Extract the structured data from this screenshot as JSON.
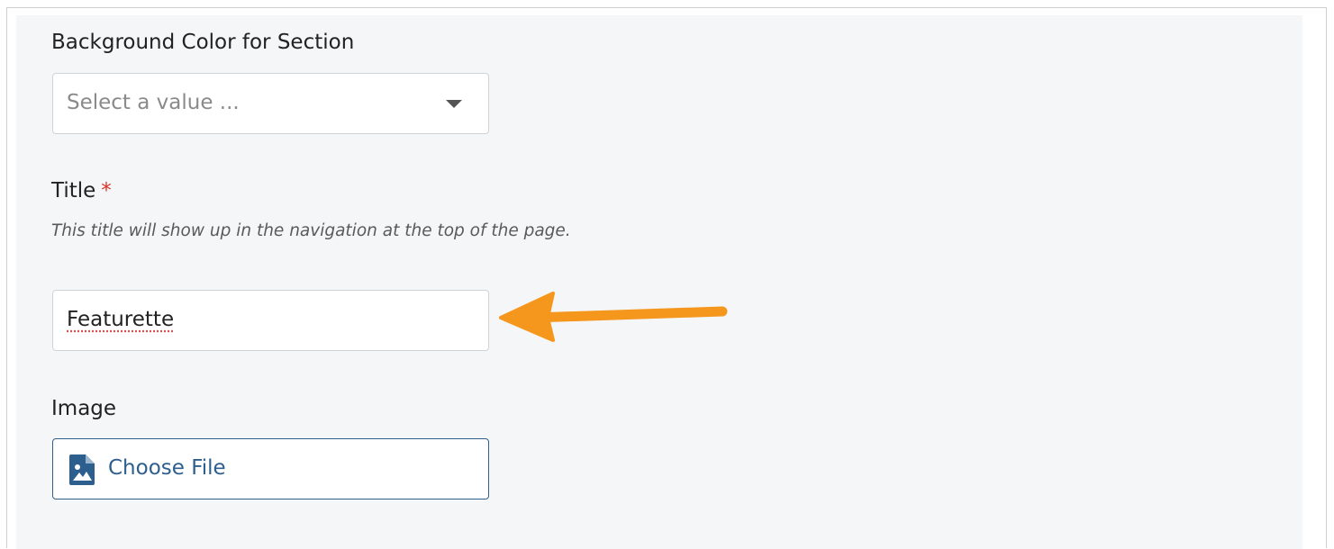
{
  "background_color_field": {
    "label": "Background Color for Section",
    "placeholder": "Select a value ..."
  },
  "title_field": {
    "label": "Title",
    "required_marker": "*",
    "help_text": "This title will show up in the navigation at the top of the page.",
    "value": "Featurette"
  },
  "image_field": {
    "label": "Image",
    "button_label": "Choose File"
  },
  "icons": {
    "dropdown": "caret-down-icon",
    "file": "file-image-icon",
    "annotation": "arrow-pointer-icon"
  },
  "colors": {
    "panel_background": "#f5f6f8",
    "required": "#d9322b",
    "link_blue": "#2d5f8e",
    "annotation_arrow": "#f5961d"
  }
}
